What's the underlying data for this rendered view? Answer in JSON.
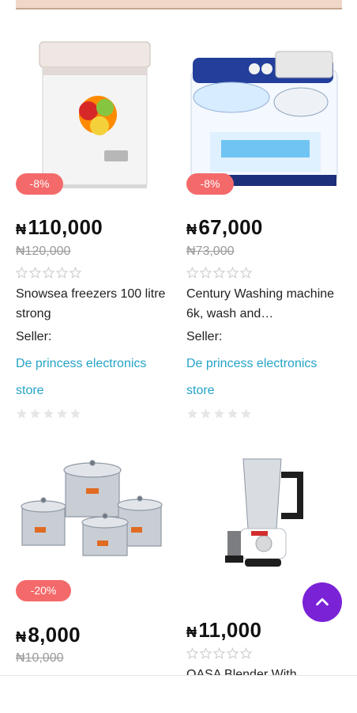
{
  "currency_symbol": "₦",
  "accent_colors": {
    "badge": "#f46a6a",
    "seller_link": "#25a3c7",
    "scroll_button": "#7a22d6"
  },
  "products": [
    {
      "image": "chest-freezer-image",
      "discount": "-8%",
      "price": "110,000",
      "old_price": "₦120,000",
      "rating_outline_stars": 5,
      "title": "Snowsea freezers 100 litre strong",
      "seller_label": "Seller:",
      "seller_name": "De princess electronics store"
    },
    {
      "image": "washing-machine-image",
      "discount": "-8%",
      "price": "67,000",
      "old_price": "₦73,000",
      "rating_outline_stars": 5,
      "title": "Century Washing machine 6k, wash and…",
      "seller_label": "Seller:",
      "seller_name": "De princess electronics store"
    },
    {
      "image": "cooking-pots-set-image",
      "discount": "-20%",
      "price": "8,000",
      "old_price": "₦10,000"
    },
    {
      "image": "blender-image",
      "price": "11,000",
      "rating_outline_stars": 5,
      "title": "OASA Blender With"
    }
  ],
  "scroll_top_icon": "chevron-up-icon"
}
